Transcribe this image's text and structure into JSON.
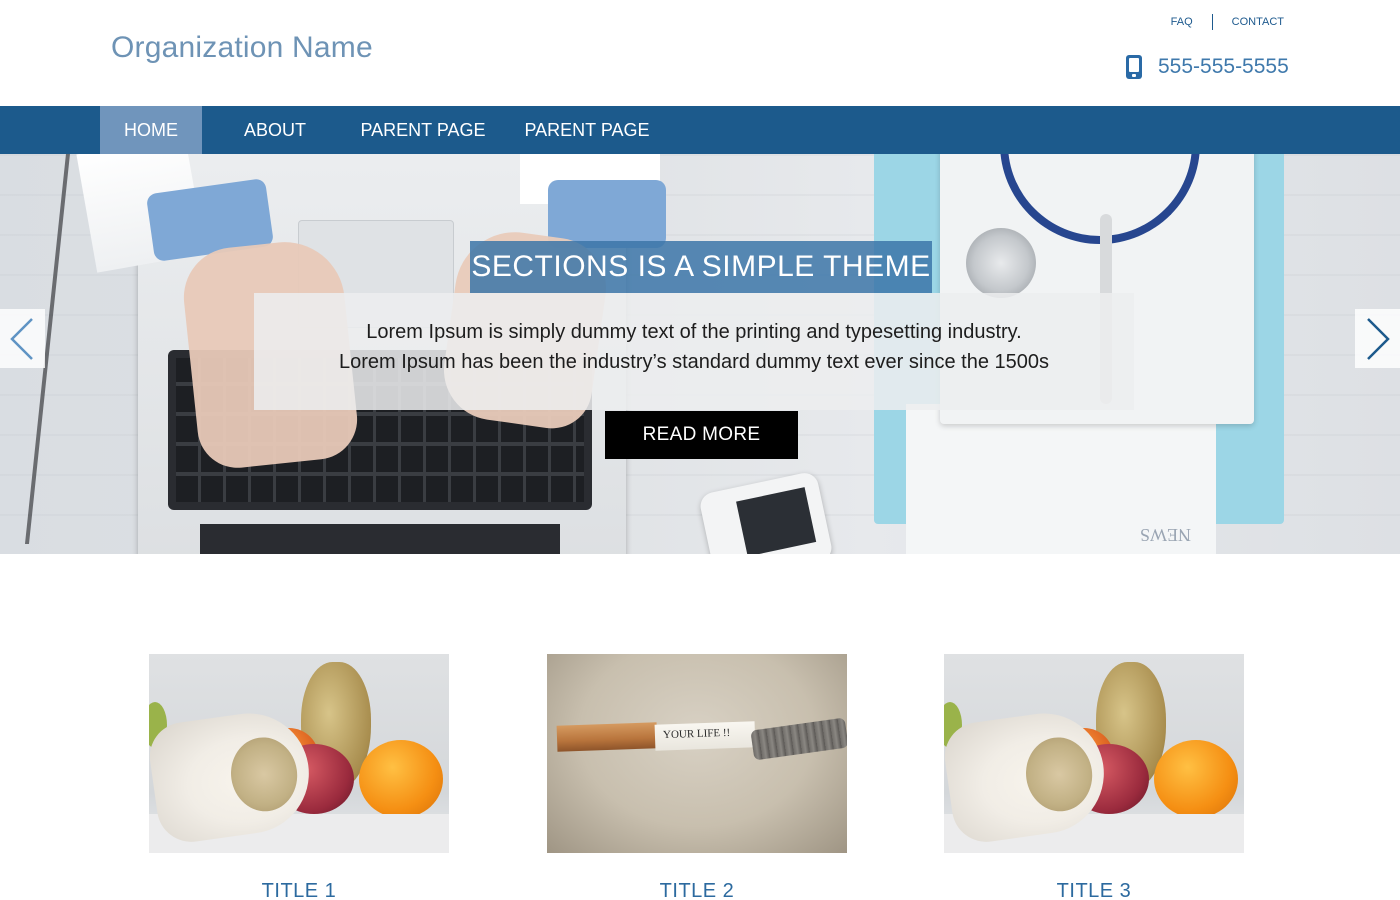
{
  "header": {
    "org_name": "Organization Name",
    "top_links": [
      {
        "label": "FAQ"
      },
      {
        "label": "CONTACT"
      }
    ],
    "phone": "555-555-5555",
    "phone_icon": "mobile-phone-icon"
  },
  "nav": {
    "items": [
      {
        "label": "HOME",
        "active": true
      },
      {
        "label": "ABOUT",
        "active": false
      },
      {
        "label": "PARENT PAGE",
        "active": false
      },
      {
        "label": "PARENT PAGE",
        "active": false
      }
    ]
  },
  "hero": {
    "title": "SECTIONS IS A SIMPLE THEME",
    "line1": "Lorem Ipsum is simply dummy text of the printing and typesetting industry.",
    "line2": "Lorem Ipsum has been the industry’s standard dummy text ever since the 1500s",
    "button_label": "READ MORE",
    "background_text": "NEWS",
    "prev_icon": "chevron-left-icon",
    "next_icon": "chevron-right-icon"
  },
  "cards": [
    {
      "title": "TITLE 1",
      "image": "fruit-and-pills"
    },
    {
      "title": "TITLE 2",
      "image": "burnt-cigarette"
    },
    {
      "title": "TITLE 3",
      "image": "fruit-and-pills"
    }
  ],
  "card_image_text": {
    "cigarette_text": "YOUR LIFE !!"
  },
  "colors": {
    "nav_bg": "#1c5a8c",
    "nav_active": "#7095bc",
    "org_name": "#6e93b5",
    "link": "#1e5a8e",
    "card_title": "#2c6a9f",
    "hero_title_bg": "#3c76a8",
    "button_bg": "#000000"
  }
}
